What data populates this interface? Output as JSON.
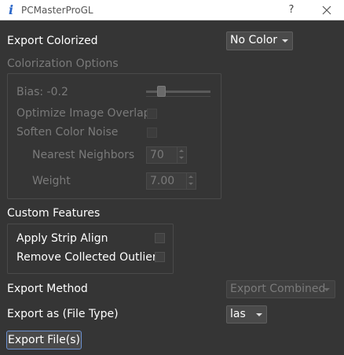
{
  "window": {
    "title": "PCMasterProGL",
    "help_label": "?"
  },
  "export_colorized": {
    "label": "Export Colorized",
    "value": "No Color"
  },
  "colorization": {
    "title": "Colorization Options",
    "bias_label": "Bias: -0.2",
    "bias_fraction": 0.2,
    "optimize_label": "Optimize Image Overlap",
    "soften_label": "Soften Color Noise",
    "nearest_label": "Nearest Neighbors",
    "nearest_value": "70",
    "weight_label": "Weight",
    "weight_value": "7.00"
  },
  "custom": {
    "title": "Custom Features",
    "strip_label": "Apply Strip Align",
    "outliers_label": "Remove Collected Outliers"
  },
  "export_method": {
    "label": "Export Method",
    "value": "Export Combined"
  },
  "export_as": {
    "label": "Export as (File Type)",
    "value": "las"
  },
  "export_button": "Export File(s)",
  "colors": {
    "background": "#353535",
    "disabled_text": "#7a7a7a",
    "focus_border": "#6a8fd0"
  }
}
